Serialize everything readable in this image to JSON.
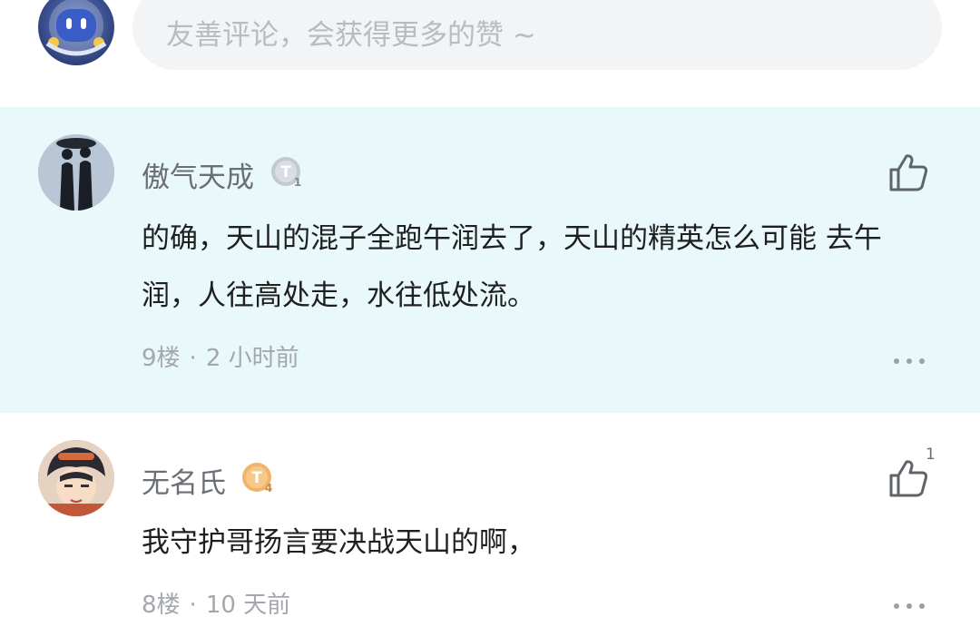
{
  "input": {
    "placeholder": "友善评论，会获得更多的赞 ~"
  },
  "comments": [
    {
      "username": "傲气天成",
      "level": "T1",
      "badge_color": "#b9c0c8",
      "content": "的确，天山的混子全跑午润去了，天山的精英怎么可能 去午润，人往高处走，水往低处流。",
      "floor": "9楼",
      "time": "2 小时前",
      "likes": ""
    },
    {
      "username": "无名氏",
      "level": "T4",
      "badge_color": "#f0b46a",
      "content": "我守护哥扬言要决战天山的啊，",
      "floor": "8楼",
      "time": "10 天前",
      "likes": "1"
    }
  ],
  "colors": {
    "highlight_bg": "#e9f8fa",
    "input_bg": "#f3f4f6",
    "meta_text": "#a4a8ae",
    "username_text": "#6b6f75",
    "body_text": "#1f1f1f"
  },
  "icons": {
    "like": "thumbs-up-icon",
    "more": "more-dots-icon",
    "badge": "level-badge-icon"
  }
}
